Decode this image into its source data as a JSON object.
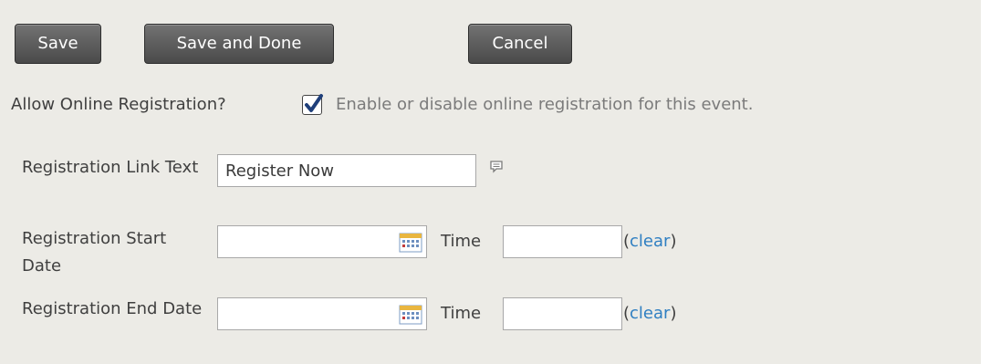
{
  "toolbar": {
    "save_label": "Save",
    "save_done_label": "Save and Done",
    "cancel_label": "Cancel"
  },
  "online_registration": {
    "label": "Allow Online Registration?",
    "checked": true,
    "hint": "Enable or disable online registration for this event."
  },
  "registration_link": {
    "label": "Registration Link Text",
    "value": "Register Now"
  },
  "start": {
    "label": "Registration Start Date",
    "date_value": "",
    "time_label": "Time",
    "time_value": "",
    "clear_open": "(",
    "clear_label": "clear",
    "clear_close": ")"
  },
  "end": {
    "label": "Registration End Date",
    "date_value": "",
    "time_label": "Time",
    "time_value": "",
    "clear_open": "(",
    "clear_label": "clear",
    "clear_close": ")"
  },
  "icons": {
    "checkbox": "checkmark-icon",
    "comment": "comment-icon",
    "calendar": "calendar-icon"
  },
  "colors": {
    "panel_bg": "#ecebe6",
    "button_bg": "#5a5a5a",
    "link": "#2f7fc2",
    "hint_text": "#7b7b7b"
  }
}
